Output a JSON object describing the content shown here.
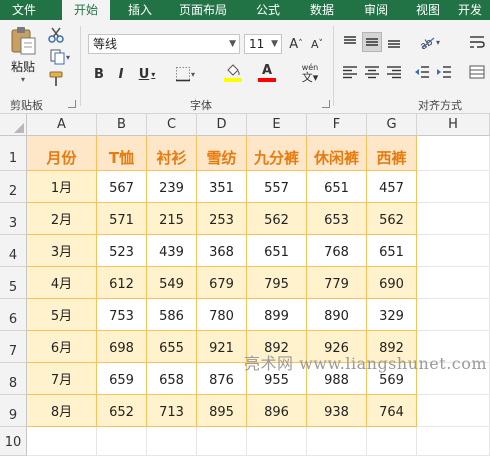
{
  "tabs": [
    {
      "label": "文件",
      "active": false
    },
    {
      "label": "开始",
      "active": true
    },
    {
      "label": "插入",
      "active": false
    },
    {
      "label": "页面布局",
      "active": false
    },
    {
      "label": "公式",
      "active": false
    },
    {
      "label": "数据",
      "active": false
    },
    {
      "label": "审阅",
      "active": false
    },
    {
      "label": "视图",
      "active": false
    },
    {
      "label": "开发",
      "active": false
    }
  ],
  "ribbon": {
    "clipboard": {
      "paste_label": "粘贴",
      "group_label": "剪贴板"
    },
    "font": {
      "font_name": "等线",
      "font_size": "11",
      "group_label": "字体",
      "bold": "B",
      "italic": "I",
      "underline": "U",
      "grow": "A",
      "shrink": "A",
      "phonetic": "wén"
    },
    "alignment": {
      "group_label": "对齐方式"
    }
  },
  "colors": {
    "accent": "#217346",
    "header_fill": "#fde7c8",
    "band_fill": "#fff2cc",
    "header_text": "#e87b10",
    "border": "#f5c25c",
    "font_color": "#ff0000",
    "fill_color": "#ffff00"
  },
  "sheet": {
    "columns": [
      "A",
      "B",
      "C",
      "D",
      "E",
      "F",
      "G",
      "H"
    ],
    "rows": [
      "1",
      "2",
      "3",
      "4",
      "5",
      "6",
      "7",
      "8",
      "9",
      "10"
    ],
    "table_header": [
      "月份",
      "T恤",
      "衬衫",
      "雪纺",
      "九分裤",
      "休闲裤",
      "西裤"
    ],
    "table_rows": [
      [
        "1月",
        "567",
        "239",
        "351",
        "557",
        "651",
        "457"
      ],
      [
        "2月",
        "571",
        "215",
        "253",
        "562",
        "653",
        "562"
      ],
      [
        "3月",
        "523",
        "439",
        "368",
        "651",
        "768",
        "651"
      ],
      [
        "4月",
        "612",
        "549",
        "679",
        "795",
        "779",
        "690"
      ],
      [
        "5月",
        "753",
        "586",
        "780",
        "899",
        "890",
        "329"
      ],
      [
        "6月",
        "698",
        "655",
        "921",
        "892",
        "926",
        "892"
      ],
      [
        "7月",
        "659",
        "658",
        "876",
        "955",
        "988",
        "569"
      ],
      [
        "8月",
        "652",
        "713",
        "895",
        "896",
        "938",
        "764"
      ]
    ]
  },
  "watermark": "亮术网 www.liangshunet.com"
}
